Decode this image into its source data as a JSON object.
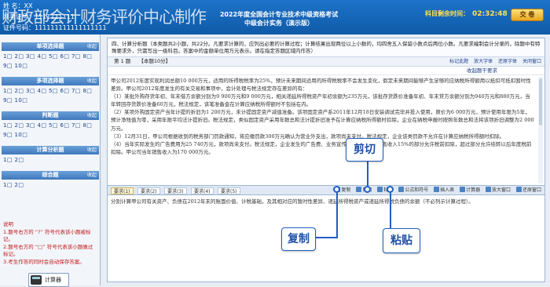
{
  "header": {
    "watermark": "财政部会计财务评价中心制作",
    "candidate_name_label": "姓    名：XX",
    "ticket_label": "准考证号：1111111111",
    "id_label": "证件号码：111111111111111111",
    "exam_title_line1": "2022年度全国会计专业技术中级资格考试",
    "exam_title_line2": "中级会计实务（演示版）",
    "timer_label": "科目剩余时间：",
    "timer_value": "02:32:48",
    "submit_label": "交 卷"
  },
  "sidebar": {
    "sections": [
      {
        "title": "单项选择题",
        "collapse": "收起",
        "rows": [
          "1□ 2□ 3□ 4□ 5□ 6□ 7□ 8□",
          "9□ 10□"
        ]
      },
      {
        "title": "多项选择题",
        "collapse": "收起",
        "rows": [
          "1□ 2□ 3□ 4□ 5□ 6□ 7□ 8□",
          "9□ 10□"
        ]
      },
      {
        "title": "判断题",
        "collapse": "收起",
        "rows": [
          "1□ 2□ 3□ 4□ 5□ 6□ 7□ 8□",
          "9□ 10□"
        ]
      },
      {
        "title": "计算分析题",
        "collapse": "收起",
        "rows": [
          "1□ 2□"
        ]
      },
      {
        "title": "综合题",
        "collapse": "收起",
        "rows": [
          "1□ 2□"
        ]
      }
    ],
    "legend": [
      "说明",
      "1.题号右方的 “?” 符号代表该小题被标记。",
      "2.题号右方的 “□” 符号代表该小题做过标记。",
      "3.考生作答的同时会自动保存答案。"
    ],
    "calculator_label": "计算器"
  },
  "main": {
    "question_header": "四、计算分析题（本类题共2小题，共22分。凡要求计算的，应列出必要的计算过程；计算结果出现两位以上小数的，均四舍五入保留小数点后两位小数。凡要求编制会计分录的，除题中有特殊要求外，只需写出一级科目。答案中的金额单位用万元表示。请在指定答题区域内作答）",
    "question_no": "第 1 题",
    "question_score": "【本题10分】",
    "tools": [
      "标记此题",
      "放大字体",
      "还原字体",
      "关闭窗口"
    ],
    "collapse_label": "收起题干要求",
    "paragraphs": [
      "甲公司2012年度实现利润总额10 000万元，适用的所得税税率为25%，预计未来期间适用的所得税税率不会发生变化，假定未来期间能够产生足够的应纳税所得额用以抵扣可抵扣暂时性差异。甲公司2012年度发生的有关交易和事项中，会计处理与税法规定存在差异的有：",
      "（1）某批外购存货年初、年末借方余额分别为9 900万元和9 000万元，相关递延所得税资产年初余额为235万元，该批存货跌价准备年初、年末贷方余额分别为940万元和880万元，当年转回存货跌价准备60万元，税法规定，该笔准备金在计算应纳税所得额时不包括在内。",
      "（2）某项外购固定资产当年计提的折旧为1 200万元，未计提固定资产减值准备。该项固定资产系2011年12月18日安装调试完毕并投入使用，原价为6 000万元，预计使用年限为5年，预计净残值为零，采用年限平均法计提折旧。税法规定，类似固定资产采用年数总和法计提折旧准予在计算应纳税所得额时扣除，企业在纳税申报时按照年数总和法将该项折旧调整为2 000万元。",
      "（3）12月31日，甲公司根据收到的税务部门罚款通知，将应缴罚款300万元确认为营业外支出，款项尚未支付。税法规定，企业该类罚款不允许在计算应纳税所得额时扣除。",
      "（4）当年实际发生的广告费用为25 740万元，款项尚未支付。税法规定，企业发生的广告费、业务宣传费不超过当年销售收入15%的部分允许税前扣除，超过部分允许结转以后年度税前扣除。甲公司当年销售收入为170 000万元。"
    ],
    "answer_tabs": [
      "要求(1)",
      "要求(2)",
      "要求(3)",
      "要求(4)",
      "要求(5)"
    ],
    "answer_tools": [
      "复制",
      "剪切",
      "粘贴",
      "公式和符号",
      "插入表",
      "计算器",
      "放大窗口",
      "还原窗口"
    ],
    "answer_prompt": "分别计算甲公司有关资产、负债在2012年末的账面价值、计税基础，及其相对应的暂时性差异、递延所得税资产或递延所得税负债的余额（不必列示计算过程）。"
  },
  "callouts": {
    "cut": "剪切",
    "copy": "复制",
    "paste": "粘贴"
  }
}
